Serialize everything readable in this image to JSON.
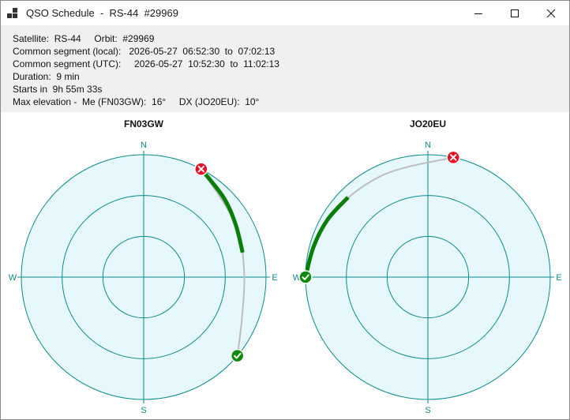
{
  "window": {
    "title": "QSO Schedule  -  RS-44  #29969",
    "icons": {
      "app": "app-grid-icon",
      "minimize": "minimize-icon",
      "maximize": "maximize-icon",
      "close": "close-icon"
    }
  },
  "info": {
    "lines": [
      "Satellite:  RS-44     Orbit:  #29969",
      "Common segment (local):   2026-05-27  06:52:30  to  07:02:13",
      "Common segment (UTC):     2026-05-27  10:52:30  to  11:02:13",
      "Duration:  9 min",
      "Starts in  9h 55m 33s",
      "Max elevation -  Me (FN03GW):  16°     DX (JO20EU):  10°"
    ]
  },
  "charts": {
    "colors": {
      "ring": "#0b8a8a",
      "fill": "#e6f8fc",
      "pass": "#bdbdbd",
      "common": "#0a7d0a",
      "start": "#0f8a0f",
      "end": "#e81123"
    },
    "compass": {
      "north": "N",
      "south": "S",
      "east": "E",
      "west": "W"
    },
    "left": {
      "title": "FN03GW",
      "pass_track": [
        {
          "az": 28,
          "el": 0
        },
        {
          "az": 60,
          "el": 12
        },
        {
          "az": 86,
          "el": 16
        },
        {
          "az": 112,
          "el": 12
        },
        {
          "az": 130,
          "el": 0
        }
      ],
      "common_track": [
        {
          "az": 28,
          "el": 0
        },
        {
          "az": 45,
          "el": 7
        },
        {
          "az": 60,
          "el": 12
        },
        {
          "az": 76,
          "el": 15
        }
      ],
      "start_marker": {
        "az": 130,
        "el": 0,
        "icon": "check-icon"
      },
      "end_marker": {
        "az": 28,
        "el": 0,
        "icon": "x-icon"
      }
    },
    "right": {
      "title": "JO20EU",
      "pass_track": [
        {
          "az": 270,
          "el": 0
        },
        {
          "az": 300,
          "el": 5
        },
        {
          "az": 335,
          "el": 8
        },
        {
          "az": 12,
          "el": 0
        }
      ],
      "common_track": [
        {
          "az": 270,
          "el": 0
        },
        {
          "az": 285,
          "el": 3
        },
        {
          "az": 300,
          "el": 5
        },
        {
          "az": 315,
          "el": 7
        }
      ],
      "start_marker": {
        "az": 270,
        "el": 0,
        "icon": "check-icon"
      },
      "end_marker": {
        "az": 12,
        "el": 0,
        "icon": "x-icon"
      }
    }
  }
}
